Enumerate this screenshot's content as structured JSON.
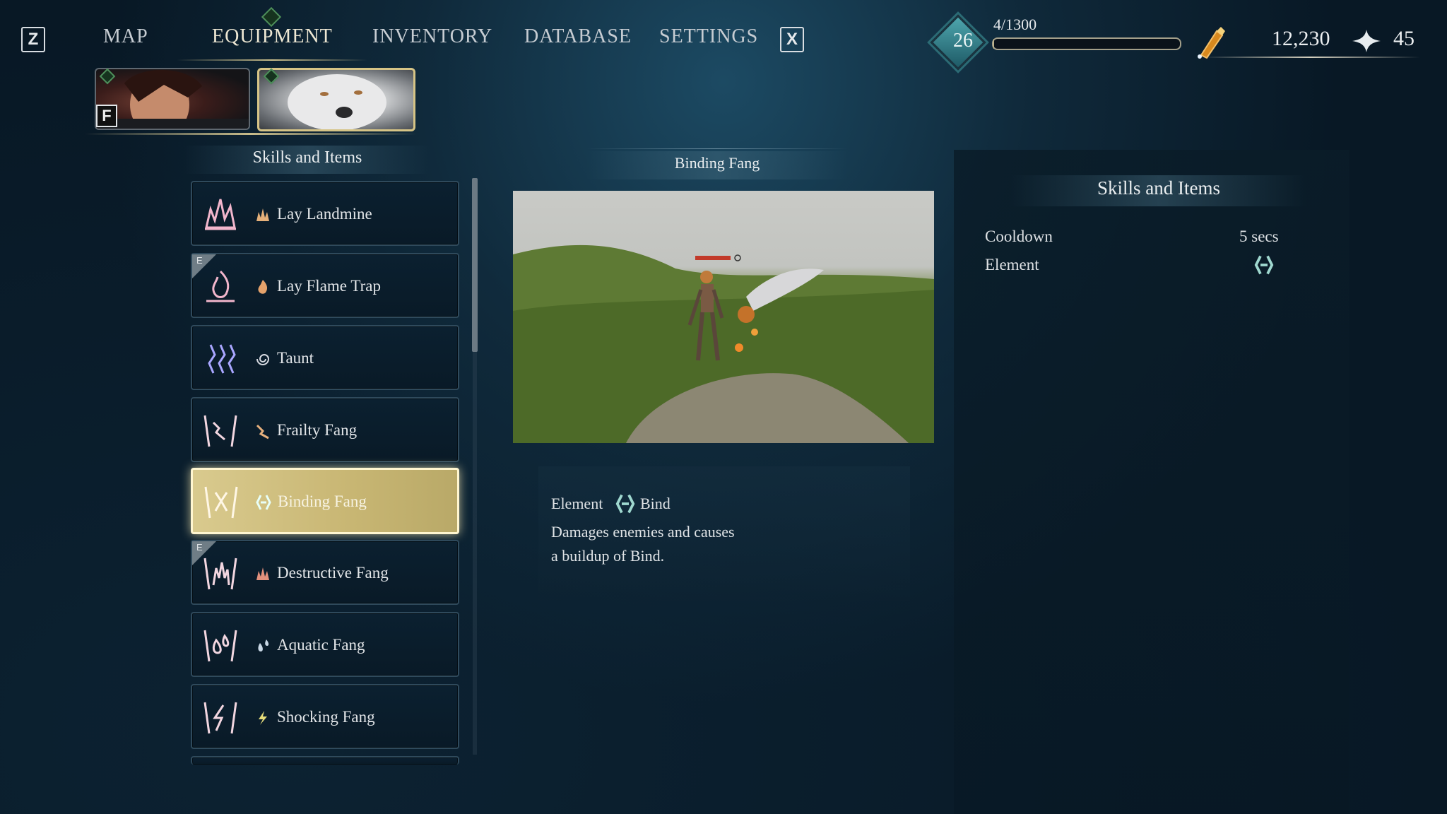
{
  "nav": {
    "left_key": "Z",
    "right_key": "X",
    "tabs": [
      {
        "label": "MAP"
      },
      {
        "label": "EQUIPMENT"
      },
      {
        "label": "INVENTORY"
      },
      {
        "label": "DATABASE"
      },
      {
        "label": "SETTINGS"
      }
    ]
  },
  "hud": {
    "level": "26",
    "xp_text": "4/1300",
    "xp_progress": 0.003,
    "gold": "12,230",
    "points": "45"
  },
  "party": {
    "switch_key": "F"
  },
  "skills_panel": {
    "title": "Skills and Items",
    "items": [
      {
        "label": "Lay Landmine",
        "equipped": false,
        "selected": false
      },
      {
        "label": "Lay Flame Trap",
        "equipped": true,
        "selected": false
      },
      {
        "label": "Taunt",
        "equipped": false,
        "selected": false
      },
      {
        "label": "Frailty Fang",
        "equipped": false,
        "selected": false
      },
      {
        "label": "Binding Fang",
        "equipped": false,
        "selected": true
      },
      {
        "label": "Destructive Fang",
        "equipped": true,
        "selected": false
      },
      {
        "label": "Aquatic Fang",
        "equipped": false,
        "selected": false
      },
      {
        "label": "Shocking Fang",
        "equipped": false,
        "selected": false
      }
    ],
    "equipped_tag": "E"
  },
  "preview": {
    "title": "Binding Fang",
    "element_label": "Element",
    "element_value": "Bind",
    "description_line1": "Damages enemies and causes",
    "description_line2": "a buildup of Bind."
  },
  "details": {
    "title": "Skills and Items",
    "cooldown_label": "Cooldown",
    "cooldown_value": "5 secs",
    "element_label": "Element"
  },
  "colors": {
    "accent_gold": "#c9bd8b",
    "selected_fill": "#d9ca8e",
    "bind_icon": "#9fd8cf"
  }
}
